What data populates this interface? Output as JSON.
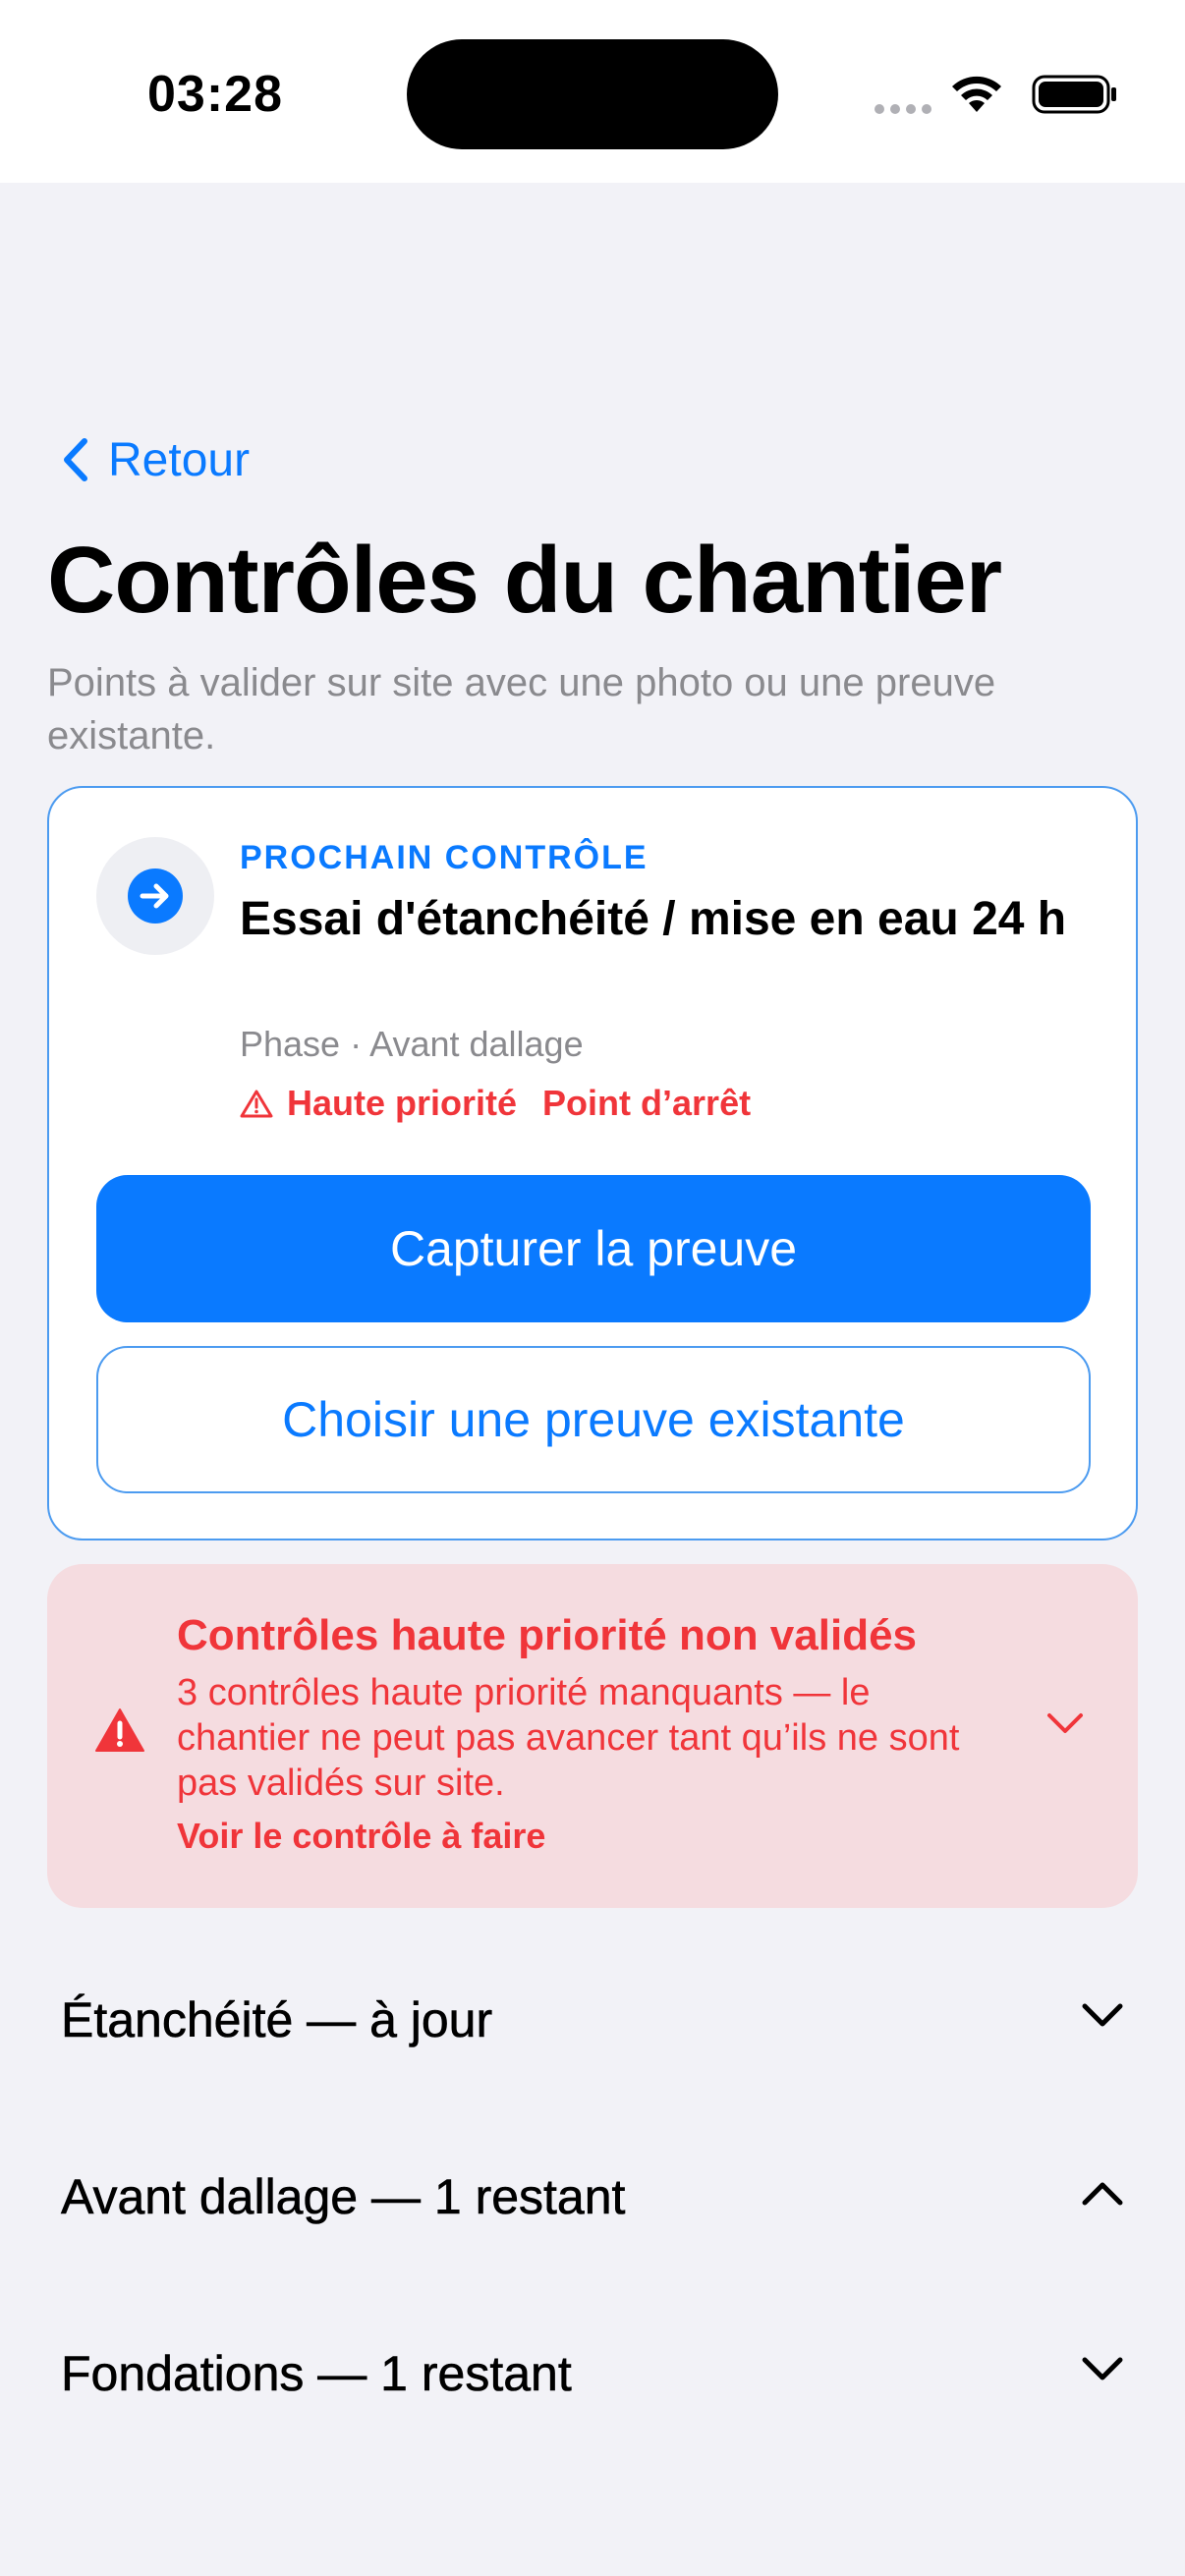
{
  "status_bar": {
    "time": "03:28",
    "icons": [
      "cellular-signal-icon",
      "wifi-icon",
      "battery-icon"
    ]
  },
  "header": {
    "back_label": "Retour",
    "title": "Contrôles du chantier",
    "subtitle": "Points à valider sur site avec une photo ou une preuve existante."
  },
  "next_control": {
    "kicker": "PROCHAIN CONTRÔLE",
    "title": "Essai d'étanchéité / mise en eau 24 h",
    "phase": "Phase · Avant dallage",
    "priority_label": "Haute priorité",
    "hold_point_label": "Point d’arrêt",
    "primary_action": "Capturer la preuve",
    "secondary_action": "Choisir une preuve existante",
    "icon": "arrow-right-circle-icon"
  },
  "alert": {
    "title": "Contrôles haute priorité non validés",
    "message": "3 contrôles haute priorité manquants — le chantier ne peut pas avancer tant qu’ils ne sont pas validés sur site.",
    "link": "Voir le contrôle à faire",
    "icon": "warning-triangle-icon"
  },
  "sections": [
    {
      "label": "Étanchéité — à jour",
      "expanded": false
    },
    {
      "label": "Avant dallage — 1 restant",
      "expanded": true
    },
    {
      "label": "Fondations — 1 restant",
      "expanded": false
    }
  ],
  "colors": {
    "accent": "#0A7AFF",
    "danger": "#F0353A",
    "alert_background": "#F5DCE0",
    "page_background": "#F2F2F7"
  }
}
